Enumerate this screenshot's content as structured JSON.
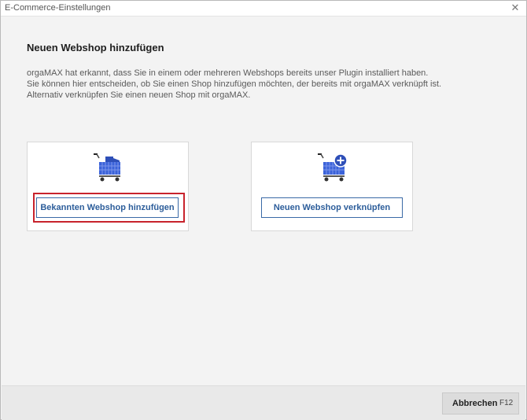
{
  "window": {
    "title": "E-Commerce-Einstellungen",
    "close_glyph": "✕"
  },
  "page": {
    "heading": "Neuen Webshop hinzufügen",
    "description": [
      "orgaMAX hat erkannt, dass Sie in einem oder mehreren Webshops bereits unser Plugin installiert haben.",
      "Sie können hier entscheiden, ob Sie einen Shop hinzufügen möchten, der bereits mit orgaMAX verknüpft ist.",
      "Alternativ verknüpfen Sie einen neuen Shop mit orgaMAX."
    ]
  },
  "cards": [
    {
      "icon": "shopping-cart-icon",
      "button_label": "Bekannten Webshop hinzufügen",
      "highlighted": true
    },
    {
      "icon": "shopping-cart-add-icon",
      "button_label": "Neuen Webshop verknüpfen",
      "highlighted": false
    }
  ],
  "footer": {
    "cancel_label": "Abbrechen",
    "cancel_shortcut": "F12"
  },
  "colors": {
    "accent": "#2c5d9a",
    "cart": "#3b63d9",
    "highlight": "#c8232c"
  }
}
